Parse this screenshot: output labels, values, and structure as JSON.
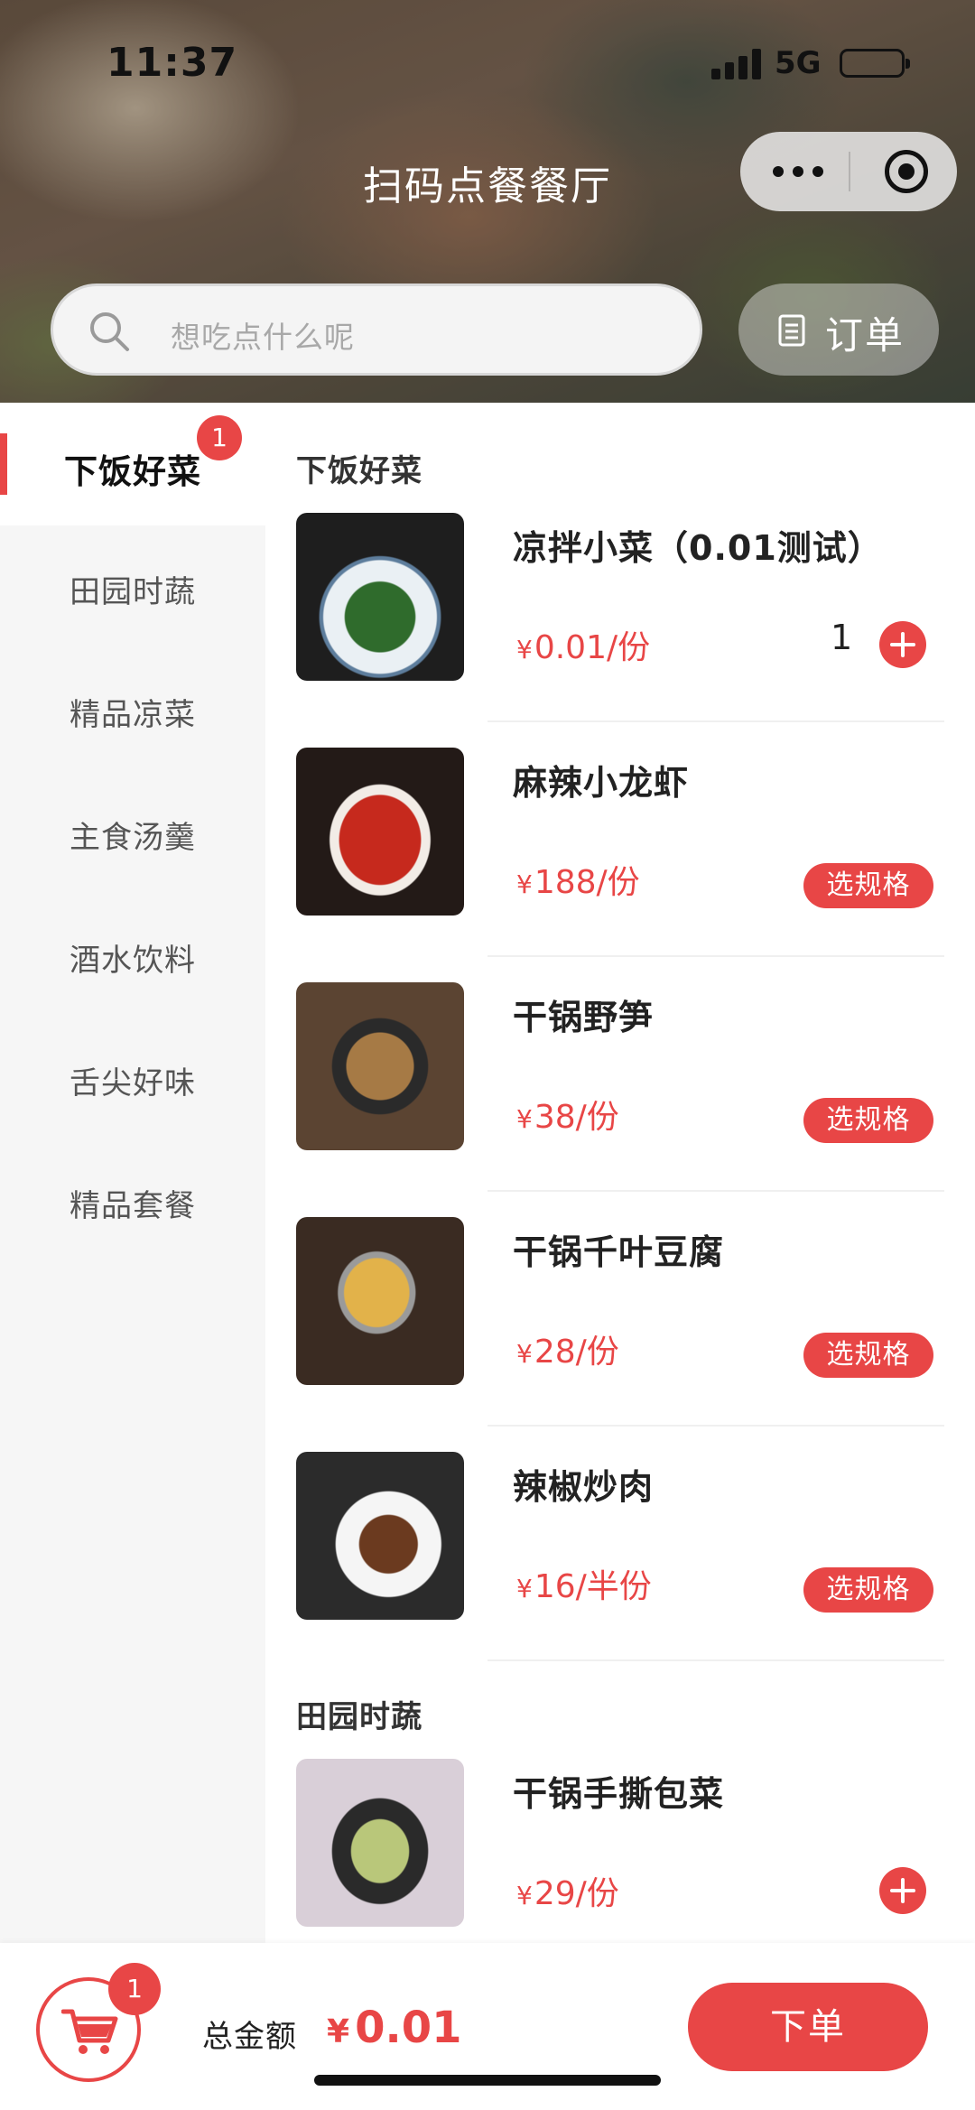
{
  "status_bar": {
    "time": "11:37",
    "network": "5G"
  },
  "header": {
    "title": "扫码点餐餐厅",
    "search_placeholder": "想吃点什么呢",
    "orders_label": "订单"
  },
  "sidebar": {
    "categories": [
      {
        "label": "下饭好菜",
        "badge": "1",
        "active": true
      },
      {
        "label": "田园时蔬"
      },
      {
        "label": "精品凉菜"
      },
      {
        "label": "主食汤羹"
      },
      {
        "label": "酒水饮料"
      },
      {
        "label": "舌尖好味"
      },
      {
        "label": "精品套餐"
      }
    ]
  },
  "menu": {
    "sections": [
      {
        "title": "下饭好菜",
        "items": [
          {
            "name": "凉拌小菜（0.01测试）",
            "currency": "¥",
            "price": "0.01/份",
            "quantity": "1",
            "action": "plus"
          },
          {
            "name": "麻辣小龙虾",
            "currency": "¥",
            "price": "188/份",
            "action_label": "选规格"
          },
          {
            "name": "干锅野笋",
            "currency": "¥",
            "price": "38/份",
            "action_label": "选规格"
          },
          {
            "name": "干锅千叶豆腐",
            "currency": "¥",
            "price": "28/份",
            "action_label": "选规格"
          },
          {
            "name": "辣椒炒肉",
            "currency": "¥",
            "price": "16/半份",
            "action_label": "选规格"
          }
        ]
      },
      {
        "title": "田园时蔬",
        "items": [
          {
            "name": "干锅手撕包菜",
            "currency": "¥",
            "price": "29/份",
            "action": "plus"
          }
        ]
      }
    ]
  },
  "cart": {
    "badge": "1",
    "total_label": "总金额",
    "currency": "¥",
    "total": "0.01",
    "submit_label": "下单"
  },
  "colors": {
    "accent": "#e84646",
    "sidebar_bg": "#f6f6f6"
  }
}
